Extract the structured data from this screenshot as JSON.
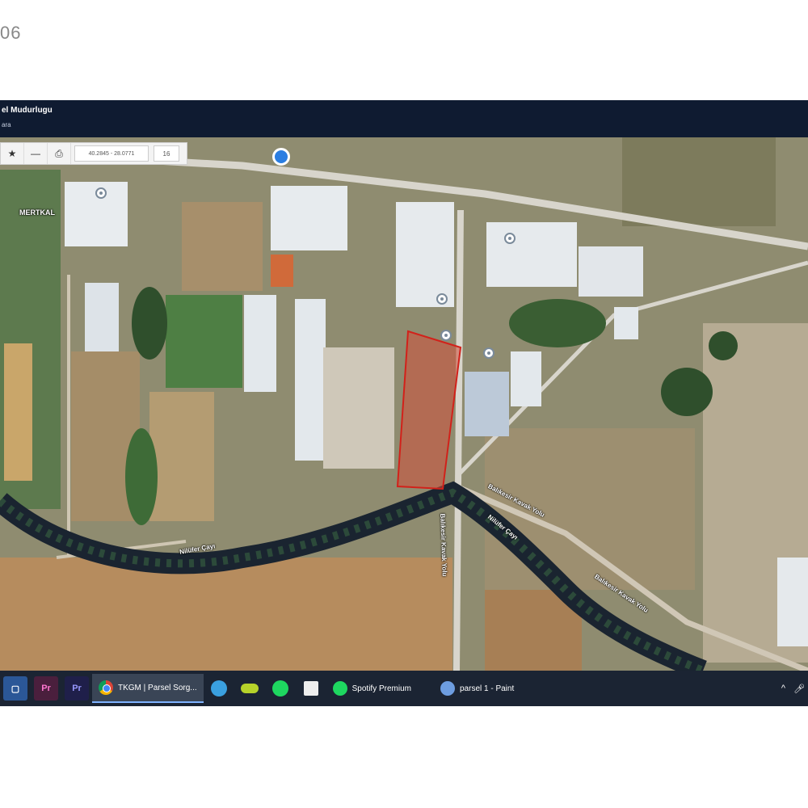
{
  "photo": {
    "corner_text": "06"
  },
  "app": {
    "title": "el Mudurlugu",
    "subtitle": "ara"
  },
  "map_toolbar": {
    "star_icon": "star-icon",
    "minus_icon": "minus-icon",
    "print_icon": "printer-icon",
    "coords": "40.2845 - 28.0771",
    "zoom": "16"
  },
  "map_labels": {
    "mertkal": "MERTKAL",
    "river_1": "Nilüfer Çayı",
    "river_2": "Nilüfer Çayı",
    "road_1": "Balıkesir Kavak Yolu",
    "road_2": "Balıkesir Kavak Yolu",
    "road_vertical": "Balıkesir Kavak Yolu"
  },
  "taskbar": {
    "chrome_label": "TKGM | Parsel Sorg...",
    "spotify_label": "Spotify Premium",
    "paint_label": "parsel 1 - Paint",
    "tray_chevron": "^"
  }
}
